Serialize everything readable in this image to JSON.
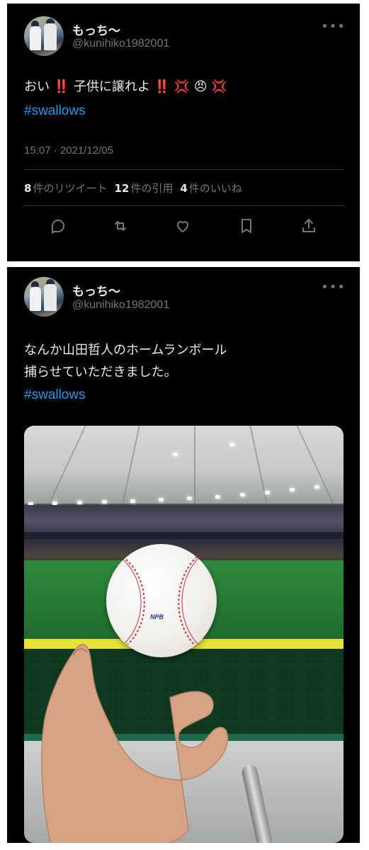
{
  "tweet1": {
    "display_name": "もっち〜",
    "handle": "@kunihiko1982001",
    "more_label": "•••",
    "text": "おい ‼️ 子供に譲れよ ‼️ 💢 😠 💢",
    "hashtag": "#swallows",
    "timestamp": "15:07 · 2021/12/05",
    "stats": {
      "retweets_count": "8",
      "retweets_label": "件のリツイート",
      "quotes_count": "12",
      "quotes_label": "件の引用",
      "likes_count": "4",
      "likes_label": "件のいいね"
    },
    "actions": [
      "reply-icon",
      "retweet-icon",
      "like-icon",
      "bookmark-icon",
      "share-icon"
    ]
  },
  "tweet2": {
    "display_name": "もっち〜",
    "handle": "@kunihiko1982001",
    "more_label": "•••",
    "text_line1": "なんか山田哲人のホームランボール",
    "text_line2": "捕らせていただきました。",
    "hashtag": "#swallows",
    "ball_logo": "NPB"
  },
  "colors": {
    "background": "#000000",
    "text": "#e7e9ea",
    "secondary": "#71767b",
    "hashtag": "#1d9bf0",
    "divider": "#2f3336"
  }
}
